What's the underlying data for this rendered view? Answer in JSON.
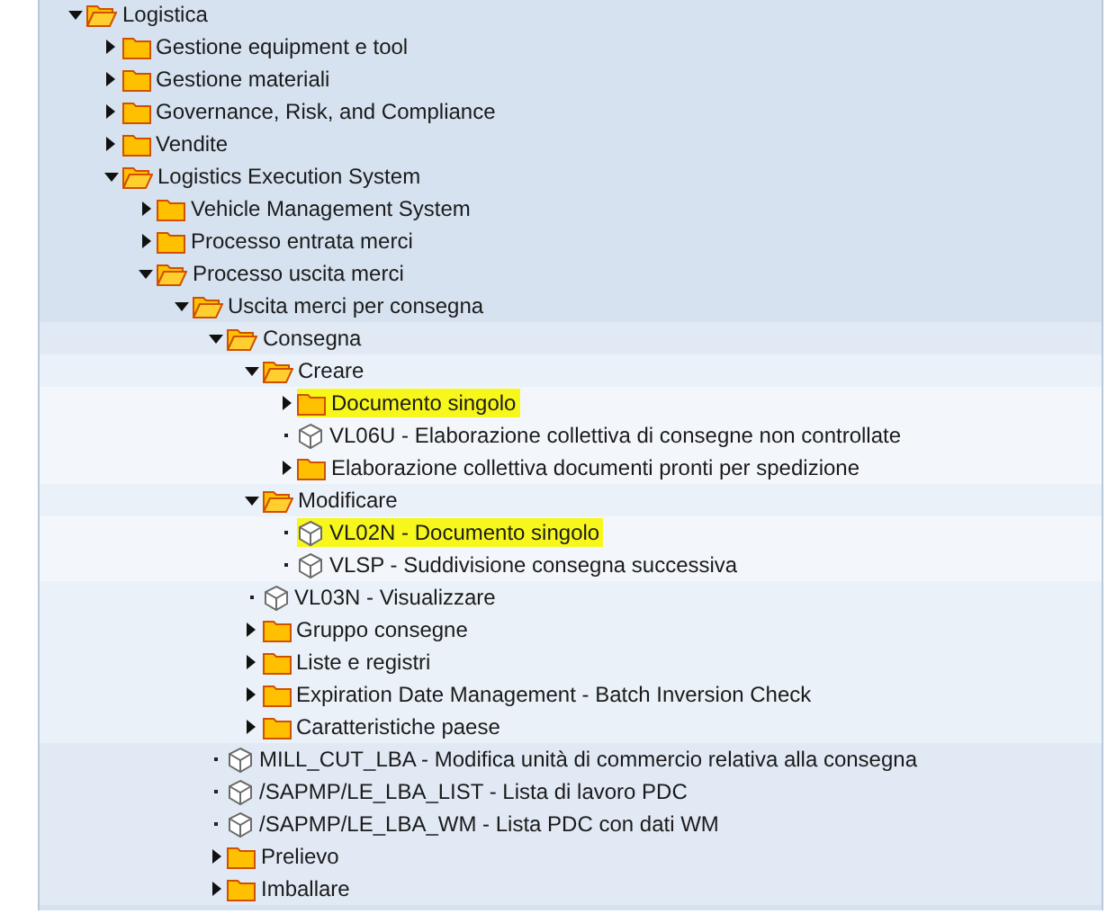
{
  "tree": [
    {
      "kind": "folder",
      "label": "Logistica",
      "expanded": true,
      "children": [
        {
          "kind": "folder",
          "label": "Gestione equipment e tool",
          "expanded": false
        },
        {
          "kind": "folder",
          "label": "Gestione materiali",
          "expanded": false
        },
        {
          "kind": "folder",
          "label": "Governance, Risk, and Compliance",
          "expanded": false
        },
        {
          "kind": "folder",
          "label": "Vendite",
          "expanded": false
        },
        {
          "kind": "folder",
          "label": "Logistics Execution System",
          "expanded": true,
          "children": [
            {
              "kind": "folder",
              "label": "Vehicle Management System",
              "expanded": false
            },
            {
              "kind": "folder",
              "label": "Processo entrata merci",
              "expanded": false
            },
            {
              "kind": "folder",
              "label": "Processo uscita merci",
              "expanded": true,
              "children": [
                {
                  "kind": "folder",
                  "label": "Uscita merci per consegna",
                  "expanded": true,
                  "children": [
                    {
                      "kind": "folder",
                      "label": "Consegna",
                      "expanded": true,
                      "children": [
                        {
                          "kind": "folder",
                          "label": "Creare",
                          "expanded": true,
                          "children": [
                            {
                              "kind": "folder",
                              "label": "Documento singolo",
                              "expanded": false,
                              "highlighted": true
                            },
                            {
                              "kind": "transaction",
                              "label": "VL06U - Elaborazione collettiva di consegne non controllate",
                              "highlighted": false
                            },
                            {
                              "kind": "folder",
                              "label": "Elaborazione collettiva documenti pronti per spedizione",
                              "expanded": false
                            }
                          ]
                        },
                        {
                          "kind": "folder",
                          "label": "Modificare",
                          "expanded": true,
                          "children": [
                            {
                              "kind": "transaction",
                              "label": "VL02N - Documento singolo",
                              "highlighted": true
                            },
                            {
                              "kind": "transaction",
                              "label": "VLSP - Suddivisione consegna successiva",
                              "highlighted": false
                            }
                          ]
                        },
                        {
                          "kind": "transaction",
                          "label": "VL03N - Visualizzare",
                          "highlighted": false
                        },
                        {
                          "kind": "folder",
                          "label": "Gruppo consegne",
                          "expanded": false
                        },
                        {
                          "kind": "folder",
                          "label": "Liste e registri",
                          "expanded": false
                        },
                        {
                          "kind": "folder",
                          "label": "Expiration Date Management - Batch Inversion Check",
                          "expanded": false
                        },
                        {
                          "kind": "folder",
                          "label": "Caratteristiche paese",
                          "expanded": false
                        }
                      ]
                    },
                    {
                      "kind": "transaction",
                      "label": "MILL_CUT_LBA - Modifica unità di commercio relativa alla consegna",
                      "highlighted": false
                    },
                    {
                      "kind": "transaction",
                      "label": "/SAPMP/LE_LBA_LIST - Lista di lavoro PDC",
                      "highlighted": false
                    },
                    {
                      "kind": "transaction",
                      "label": "/SAPMP/LE_LBA_WM - Lista PDC con dati WM",
                      "highlighted": false
                    },
                    {
                      "kind": "folder",
                      "label": "Prelievo",
                      "expanded": false
                    },
                    {
                      "kind": "folder",
                      "label": "Imballare",
                      "expanded": false
                    }
                  ]
                }
              ]
            }
          ]
        }
      ]
    }
  ]
}
